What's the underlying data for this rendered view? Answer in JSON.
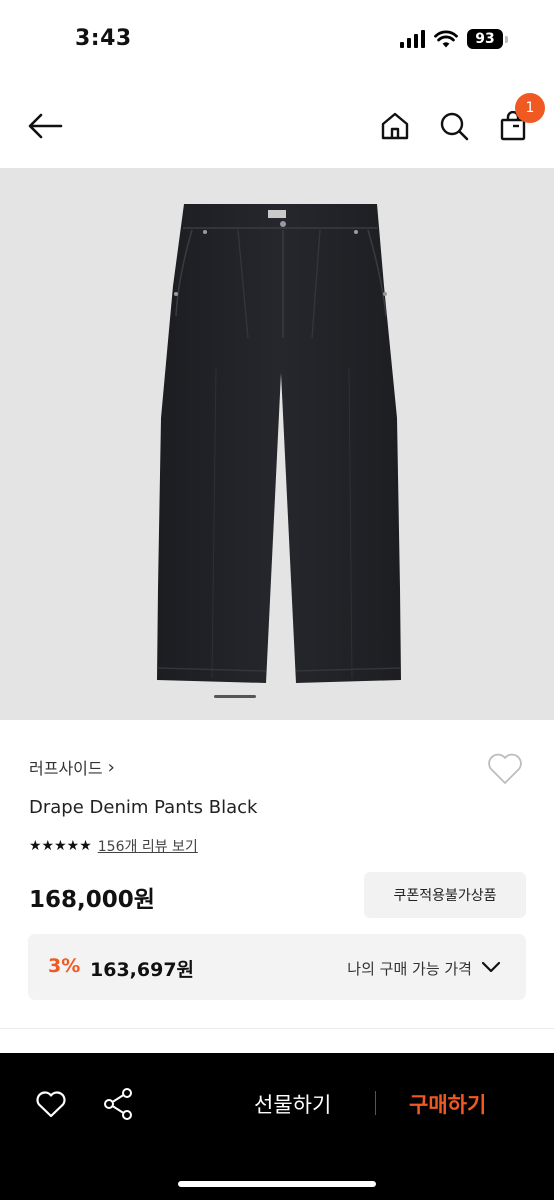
{
  "status_bar": {
    "time": "3:43",
    "battery": "93",
    "icons": [
      "signal-icon",
      "wifi-icon",
      "battery-icon"
    ]
  },
  "nav": {
    "cart_count": "1",
    "icons": [
      "back-arrow-icon",
      "home-icon",
      "search-icon",
      "shopping-bag-icon"
    ]
  },
  "product": {
    "brand": "러프사이드",
    "name": "Drape Denim Pants Black",
    "rating_stars": "★★★★★",
    "review_link": "156개 리뷰 보기",
    "price": "168,000원",
    "coupon_notice": "쿠폰적용불가상품",
    "discount_rate": "3%",
    "final_price": "163,697원",
    "my_price_label": "나의 구매 가능 가격",
    "image_count_indicator": "1"
  },
  "bottom_bar": {
    "gift_label": "선물하기",
    "buy_label": "구매하기",
    "icons": [
      "heart-icon",
      "share-icon"
    ]
  },
  "colors": {
    "accent": "#f05a22",
    "image_bg": "#e4e4e4",
    "bottom_bar_bg": "#000000"
  }
}
